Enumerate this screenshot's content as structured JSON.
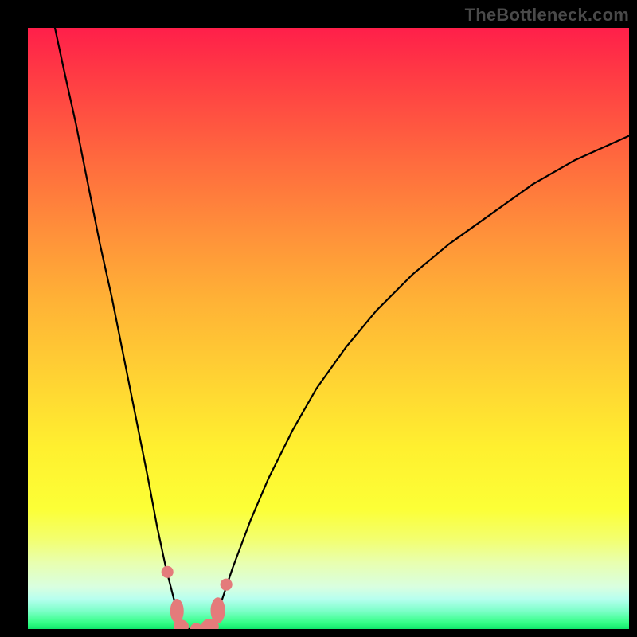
{
  "watermark": "TheBottleneck.com",
  "chart_data": {
    "type": "line",
    "title": "",
    "xlabel": "",
    "ylabel": "",
    "xlim": [
      0,
      100
    ],
    "ylim": [
      0,
      100
    ],
    "grid": false,
    "legend": false,
    "annotations": [],
    "background_gradient": {
      "direction": "vertical",
      "stops": [
        {
          "pos": 0.0,
          "color": "#ff1f4a"
        },
        {
          "pos": 0.35,
          "color": "#ff903a"
        },
        {
          "pos": 0.7,
          "color": "#fff02f"
        },
        {
          "pos": 0.95,
          "color": "#b7ffef"
        },
        {
          "pos": 1.0,
          "color": "#12e86c"
        }
      ]
    },
    "series": [
      {
        "name": "left-branch",
        "x": [
          4.5,
          6,
          8,
          10,
          12,
          14,
          16,
          18,
          20,
          21.5,
          23,
          24.8,
          25.5
        ],
        "y": [
          100,
          93,
          84,
          74,
          64,
          55,
          45,
          35,
          25,
          17,
          10,
          3,
          0.3
        ],
        "stroke": "#000000"
      },
      {
        "name": "right-branch",
        "x": [
          30.5,
          32,
          34,
          37,
          40,
          44,
          48,
          53,
          58,
          64,
          70,
          77,
          84,
          91,
          99.9
        ],
        "y": [
          0.3,
          4,
          10,
          18,
          25,
          33,
          40,
          47,
          53,
          59,
          64,
          69,
          74,
          78,
          82
        ],
        "stroke": "#000000"
      },
      {
        "name": "valley-floor",
        "x": [
          25.5,
          26.5,
          28,
          29.5,
          30.5
        ],
        "y": [
          0.3,
          0.0,
          0.0,
          0.0,
          0.3
        ],
        "stroke": "#000000"
      }
    ],
    "markers": [
      {
        "x": 23.2,
        "y": 9.5,
        "r": 1.0,
        "color": "#e47b7b",
        "shape": "dot"
      },
      {
        "x": 24.8,
        "y": 3.0,
        "r": 1.5,
        "color": "#e47b7b",
        "shape": "blob-vert"
      },
      {
        "x": 25.5,
        "y": 0.4,
        "r": 1.2,
        "color": "#e47b7b",
        "shape": "blob"
      },
      {
        "x": 28.0,
        "y": 0.0,
        "r": 1.0,
        "color": "#e47b7b",
        "shape": "dot"
      },
      {
        "x": 30.3,
        "y": 0.4,
        "r": 1.4,
        "color": "#e47b7b",
        "shape": "blob"
      },
      {
        "x": 31.6,
        "y": 3.1,
        "r": 1.6,
        "color": "#e47b7b",
        "shape": "blob-vert"
      },
      {
        "x": 33.0,
        "y": 7.4,
        "r": 1.0,
        "color": "#e47b7b",
        "shape": "dot"
      }
    ]
  }
}
